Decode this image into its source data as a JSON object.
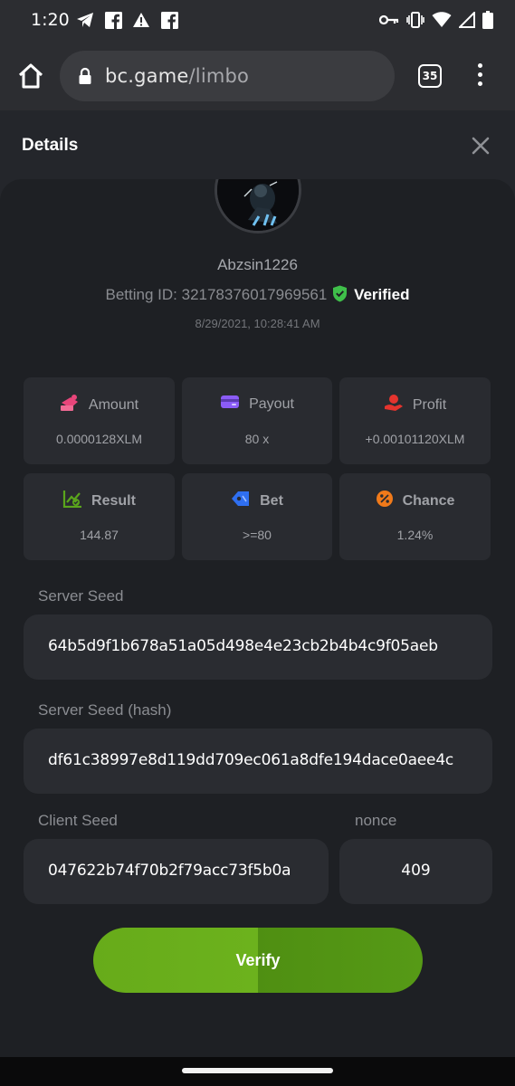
{
  "status_bar": {
    "time": "1:20",
    "left_icons": [
      "telegram-icon",
      "facebook-icon",
      "warning-icon",
      "facebook-icon"
    ],
    "right_icons": [
      "key-icon",
      "vibrate-icon",
      "wifi-icon",
      "signal-icon",
      "battery-icon"
    ]
  },
  "browser": {
    "url_domain": "bc.game",
    "url_path": "/limbo",
    "tab_count": "35"
  },
  "details": {
    "title": "Details",
    "username": "Abzsin1226",
    "betting_id_label": "Betting ID:",
    "betting_id": "32178376017969561",
    "verified_label": "Verified",
    "datetime": "8/29/2021, 10:28:41 AM"
  },
  "stats": [
    {
      "icon": "amount-icon",
      "label": "Amount",
      "value": "0.0000128XLM",
      "color": "#e8457a"
    },
    {
      "icon": "payout-icon",
      "label": "Payout",
      "value": "80 x",
      "color": "#8b5cf6"
    },
    {
      "icon": "profit-icon",
      "label": "Profit",
      "value": "+0.00101120XLM",
      "color": "#e5342e"
    },
    {
      "icon": "result-icon",
      "label": "Result",
      "value": "144.87",
      "color": "#5aa51c"
    },
    {
      "icon": "bet-icon",
      "label": "Bet",
      "value": ">=80",
      "color": "#2f6ff0"
    },
    {
      "icon": "chance-icon",
      "label": "Chance",
      "value": "1.24%",
      "color": "#f07a1a"
    }
  ],
  "seeds": {
    "server_seed_label": "Server Seed",
    "server_seed": "64b5d9f1b678a51a05d498e4e23cb2b4b4c9f05aeb",
    "server_seed_hash_label": "Server Seed (hash)",
    "server_seed_hash": "df61c38997e8d119dd709ec061a8dfe194dace0aee4c",
    "client_seed_label": "Client Seed",
    "client_seed": "047622b74f70b2f79acc73f5b0a",
    "nonce_label": "nonce",
    "nonce": "409"
  },
  "verify_button": "Verify",
  "colors": {
    "accent_green": "#6cb21d",
    "verified_green": "#3fbf4a",
    "panel_bg": "#1e2024",
    "card_bg": "#292b30"
  }
}
